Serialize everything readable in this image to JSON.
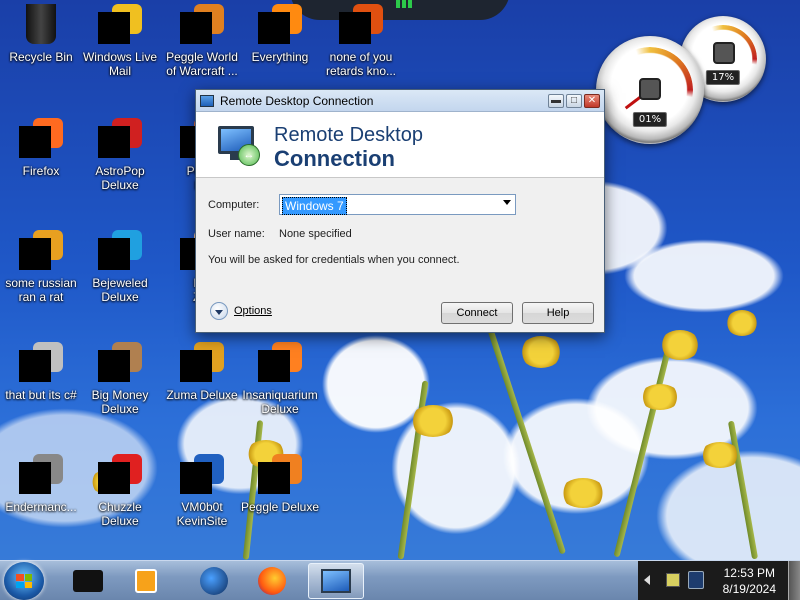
{
  "desktop_icons": [
    {
      "label": "Recycle Bin"
    },
    {
      "label": "Windows Live\nMail"
    },
    {
      "label": "Peggle World\nof Warcraft ..."
    },
    {
      "label": "Everything"
    },
    {
      "label": "none of you\nretards kno..."
    },
    {
      "label": "Firefox"
    },
    {
      "label": "AstroPop\nDeluxe"
    },
    {
      "label": "Peggl\nDe"
    },
    {
      "label": "some russian\nran a rat"
    },
    {
      "label": "Bejeweled\nDeluxe"
    },
    {
      "label": "Pla\nZor"
    },
    {
      "label": "that but its c#"
    },
    {
      "label": "Big Money\nDeluxe"
    },
    {
      "label": "Zuma Deluxe"
    },
    {
      "label": "Insaniquarium\nDeluxe"
    },
    {
      "label": "Endermanc..."
    },
    {
      "label": "Chuzzle\nDeluxe"
    },
    {
      "label": "VM0b0t\nKevinSite"
    },
    {
      "label": "Peggle Deluxe"
    }
  ],
  "gadget": {
    "cpu_reading": "01%",
    "memory_reading": "17%",
    "cpu_level": 0.01,
    "memory_level": 0.17
  },
  "window": {
    "title": "Remote Desktop Connection",
    "banner_line1": "Remote Desktop",
    "banner_line2": "Connection",
    "computer_label": "Computer:",
    "computer_value": "Windows 7",
    "username_label": "User name:",
    "username_value": "None specified",
    "credentials_note": "You will be asked for credentials when you connect.",
    "options_label": "Options",
    "connect_label": "Connect",
    "help_label": "Help",
    "minimize_glyph": "▬",
    "maximize_glyph": "□",
    "close_glyph": "✕"
  },
  "taskbar": {
    "items": [
      {
        "icon": "window-icon"
      },
      {
        "icon": "media-player-icon"
      },
      {
        "icon": "globe-icon"
      },
      {
        "icon": "firefox-icon"
      },
      {
        "icon": "remote-desktop-icon",
        "active": true
      }
    ],
    "time": "12:53 PM",
    "date": "8/19/2024"
  },
  "colors": {
    "title_text": "#1a3f73",
    "selection": "#3399ff"
  }
}
